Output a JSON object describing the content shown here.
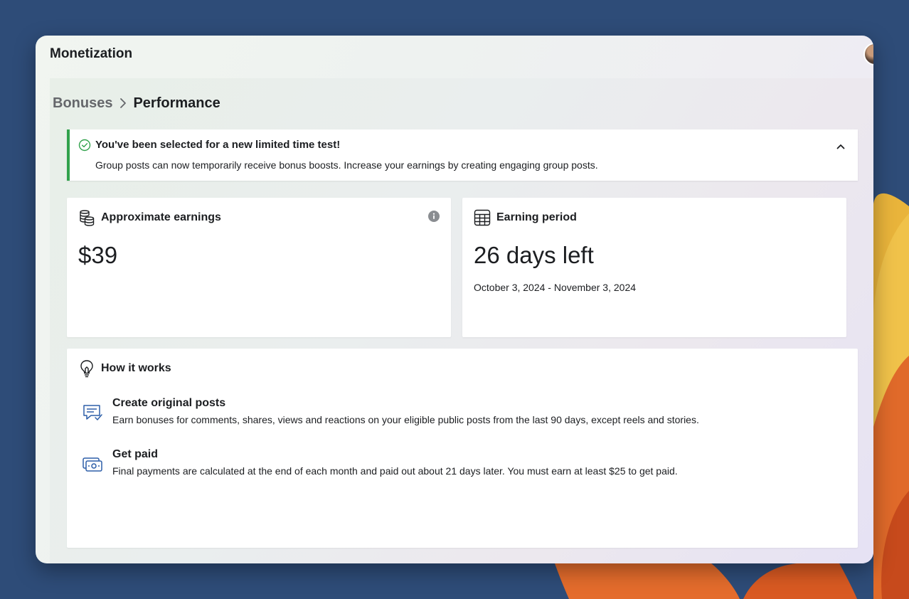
{
  "app": {
    "title": "Monetization"
  },
  "breadcrumb": {
    "parent": "Bonuses",
    "current": "Performance"
  },
  "banner": {
    "title": "You've been selected for a new limited time test!",
    "text": "Group posts can now temporarily receive bonus boosts. Increase your earnings by creating engaging group posts.",
    "accent": "#31a24c"
  },
  "earnings": {
    "title": "Approximate earnings",
    "value": "$39",
    "icon": "coins-stack-icon"
  },
  "period": {
    "title": "Earning period",
    "value": "26 days left",
    "range": "October 3, 2024 - November 3, 2024",
    "icon": "calendar-grid-icon"
  },
  "how": {
    "title": "How it works",
    "icon": "lightbulb-icon",
    "steps": [
      {
        "title": "Create original posts",
        "desc": "Earn bonuses for comments, shares, views and reactions on your eligible public posts from the last 90 days, except reels and stories.",
        "icon": "post-check-icon"
      },
      {
        "title": "Get paid",
        "desc": "Final payments are calculated at the end of each month and paid out about 21 days later. You must earn at least $25 to get paid.",
        "icon": "money-bills-icon"
      }
    ]
  },
  "colors": {
    "desktop": "#2e4c78",
    "brand_blue": "#2d5ea8",
    "wallpaper_orange": "#e46c2c",
    "wallpaper_yellow": "#f0c24a"
  }
}
